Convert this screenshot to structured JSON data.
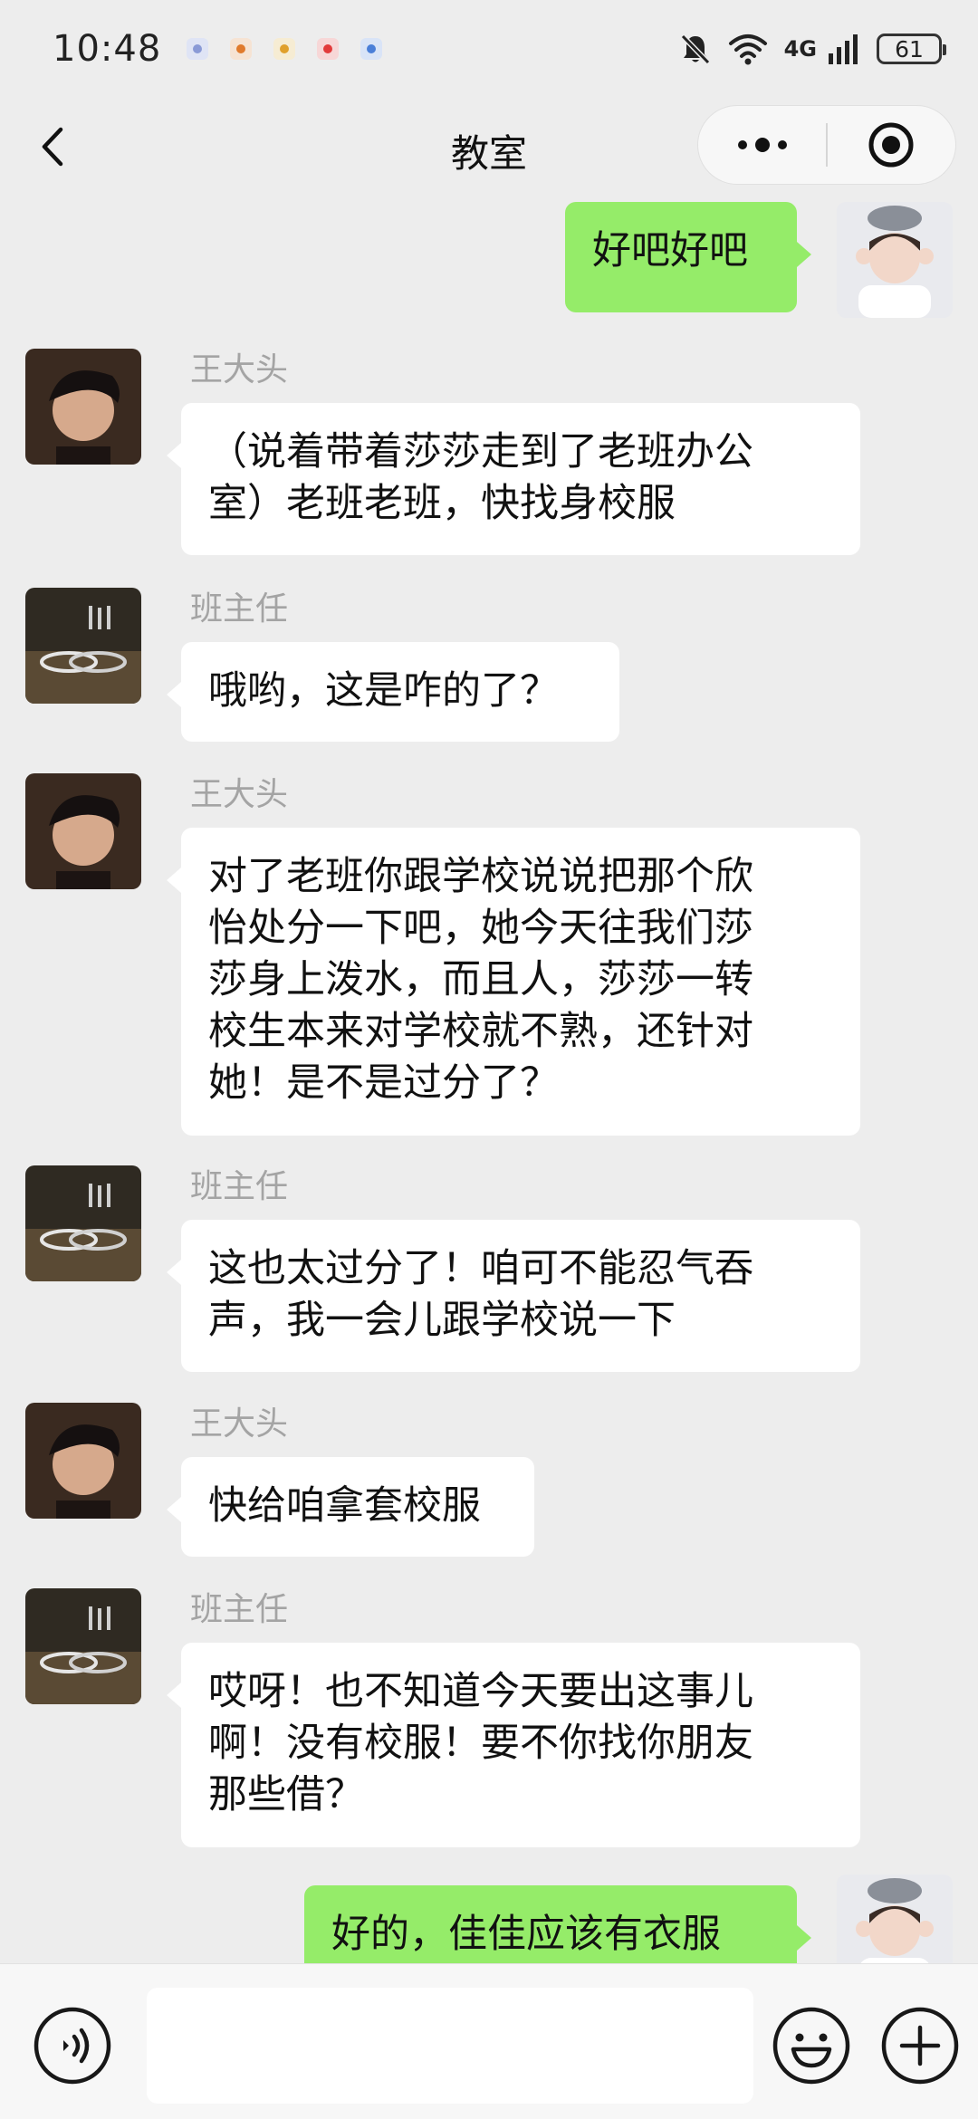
{
  "status_bar": {
    "time": "10:48",
    "network_label": "4G",
    "battery_level": "61",
    "notification_icons": [
      {
        "name": "app-notification-icon",
        "color": "#8a9ad6"
      },
      {
        "name": "app-notification-icon",
        "color": "#e07a2c"
      },
      {
        "name": "app-notification-icon",
        "color": "#e0a02c"
      },
      {
        "name": "app-notification-icon",
        "color": "#e23b3b"
      },
      {
        "name": "app-notification-icon",
        "color": "#4a7fd8"
      }
    ],
    "icons": [
      "mute-bell-icon",
      "wifi-icon",
      "signal-icon",
      "battery-icon"
    ]
  },
  "header": {
    "title": "教室",
    "icons": [
      "chevron-left-icon",
      "more-dots-icon",
      "target-close-icon"
    ]
  },
  "participants": {
    "wangdatou": "王大头",
    "teacher": "班主任"
  },
  "messages": [
    {
      "side": "right",
      "text": "好吧好吧"
    },
    {
      "side": "left",
      "sender": "王大头",
      "text": "（说着带着莎莎走到了老班办公\n室）老班老班，快找身校服"
    },
    {
      "side": "left",
      "sender": "班主任",
      "text": "哦哟，这是咋的了？"
    },
    {
      "side": "left",
      "sender": "王大头",
      "text": "对了老班你跟学校说说把那个欣\n怡处分一下吧，她今天往我们莎\n莎身上泼水，而且人，莎莎一转\n校生本来对学校就不熟，还针对\n她！是不是过分了？"
    },
    {
      "side": "left",
      "sender": "班主任",
      "text": "这也太过分了！咱可不能忍气吞\n声，我一会儿跟学校说一下"
    },
    {
      "side": "left",
      "sender": "王大头",
      "text": "快给咱拿套校服"
    },
    {
      "side": "left",
      "sender": "班主任",
      "text": "哎呀！也不知道今天要出这事儿\n啊！没有校服！要不你找你朋友\n那些借？"
    },
    {
      "side": "right",
      "text": "好的，佳佳应该有衣服"
    }
  ],
  "input_bar": {
    "placeholder": "",
    "icons": [
      "voice-icon",
      "emoji-icon",
      "plus-icon"
    ]
  },
  "colors": {
    "background": "#ededed",
    "bubble_self": "#95ec69",
    "bubble_other": "#ffffff",
    "sender_name": "#a4a4a4"
  }
}
